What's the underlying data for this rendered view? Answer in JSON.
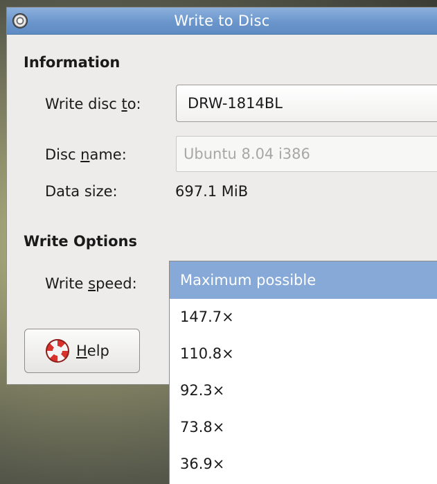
{
  "window": {
    "title": "Write to Disc"
  },
  "information": {
    "heading": "Information",
    "write_disc_to": {
      "label_pre": "Write disc ",
      "label_mnemonic": "t",
      "label_post": "o:",
      "value": "DRW-1814BL"
    },
    "disc_name": {
      "label_pre": "Disc ",
      "label_mnemonic": "n",
      "label_post": "ame:",
      "placeholder": "Ubuntu 8.04 i386"
    },
    "data_size": {
      "label": "Data size:",
      "value": "697.1 MiB"
    }
  },
  "write_options": {
    "heading": "Write Options",
    "write_speed": {
      "label_pre": "Write ",
      "label_mnemonic": "s",
      "label_post": "peed:"
    }
  },
  "speed_dropdown": {
    "options": [
      "Maximum possible",
      "147.7×",
      "110.8×",
      "92.3×",
      "73.8×",
      "36.9×"
    ],
    "selected": "Maximum possible"
  },
  "buttons": {
    "help": {
      "mnemonic": "H",
      "rest": "elp"
    }
  },
  "icons": {
    "window": "disc-burner-icon",
    "help": "lifebuoy-icon"
  },
  "colors": {
    "titlebar": "#6b96cc",
    "selection": "#86a9d8"
  }
}
